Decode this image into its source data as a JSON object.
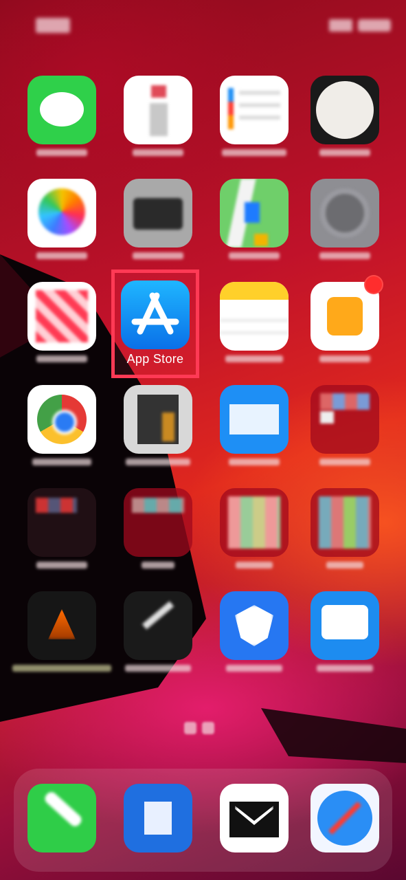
{
  "status_bar": {
    "time_icon": "time-text-blurred",
    "signal_icon": "signal-wifi-icon",
    "battery_icon": "battery-icon"
  },
  "highlighted_app": {
    "label": "App Store",
    "icon": "app-store-icon"
  },
  "apps": {
    "row1": [
      "messages-icon",
      "photos-app-icon",
      "reminders-icon",
      "clock-icon"
    ],
    "row2": [
      "photos-icon",
      "camera-icon",
      "maps-icon",
      "settings-icon"
    ],
    "row3": [
      "news-icon",
      "app-store-icon",
      "notes-icon",
      "home-icon"
    ],
    "row4": [
      "chrome-icon",
      "calculator-icon",
      "mail-icon",
      "folder-icon"
    ],
    "row5": [
      "folder-icon",
      "folder-icon",
      "folder-icon",
      "folder-icon"
    ],
    "row6": [
      "dark-app-icon",
      "dark-app-icon",
      "shield-app-icon",
      "chat-app-icon"
    ]
  },
  "dock": [
    "phone-icon",
    "clipboard-app-icon",
    "gmail-icon",
    "safari-icon"
  ],
  "colors": {
    "highlight": "#ff3a55",
    "app_store_blue": "#1fb6ff",
    "badge": "#ff2d2d"
  }
}
